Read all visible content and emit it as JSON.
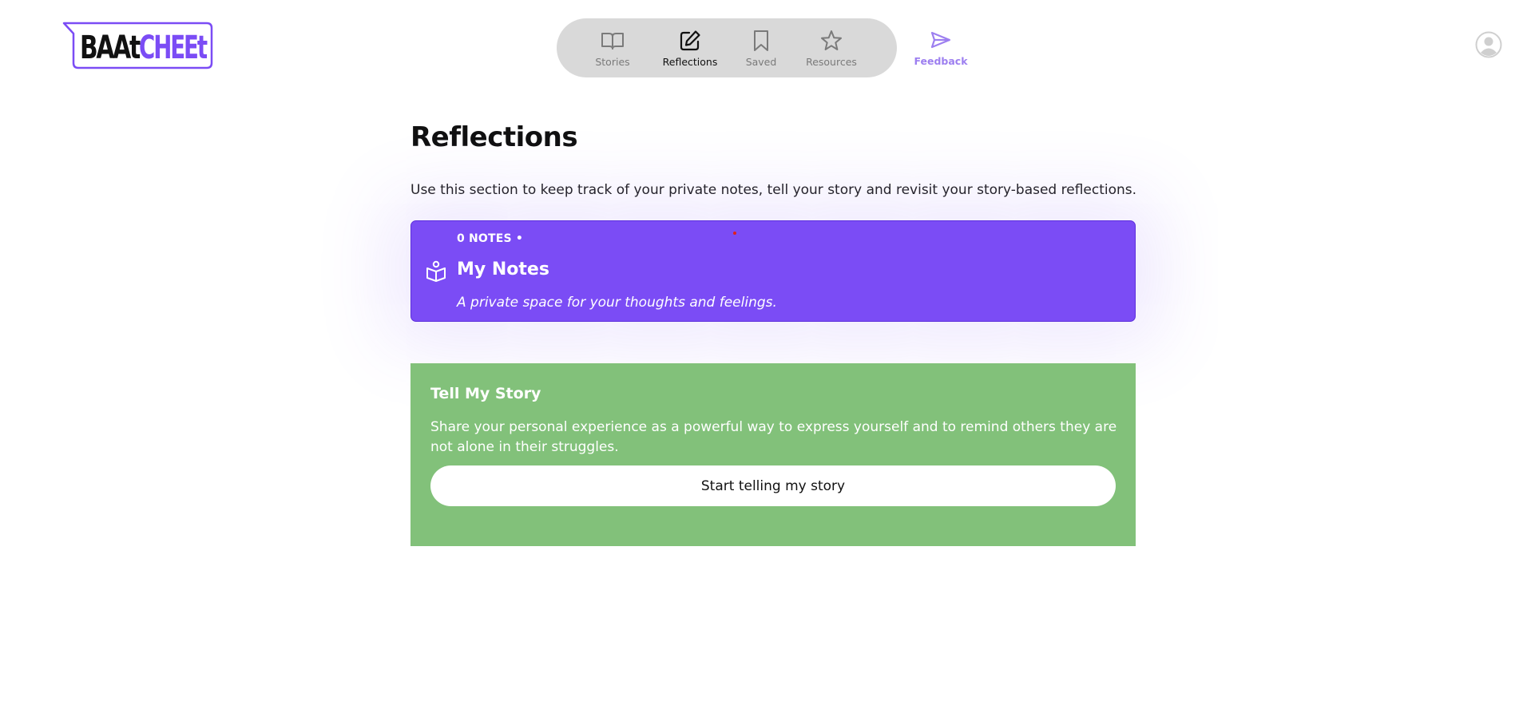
{
  "brand": {
    "logo_text_dark": "BAAt",
    "logo_text_accent": "CHEEt",
    "accent_color": "#7b4cf5"
  },
  "nav": {
    "items": [
      {
        "label": "Stories",
        "icon": "book-open-icon",
        "active": false
      },
      {
        "label": "Reflections",
        "icon": "edit-square-icon",
        "active": true
      },
      {
        "label": "Saved",
        "icon": "bookmark-icon",
        "active": false
      },
      {
        "label": "Resources",
        "icon": "star-icon",
        "active": false
      }
    ],
    "feedback": {
      "label": "Feedback",
      "icon": "send-icon"
    }
  },
  "user": {
    "icon": "user-avatar-icon"
  },
  "main": {
    "title": "Reflections",
    "intro": "Use this section to keep track of your private notes, tell your story and revisit your story-based reflections."
  },
  "notes_card": {
    "count_label": "0 NOTES •",
    "title": "My Notes",
    "subtitle": "A private space for your thoughts and feelings.",
    "icon": "notes-book-icon",
    "color": "#7b4cf5"
  },
  "story_card": {
    "title": "Tell My Story",
    "description": "Share your personal experience as a powerful way to express yourself and to remind others they are not alone in their struggles.",
    "button_label": "Start telling my story",
    "color": "#82c17a"
  }
}
